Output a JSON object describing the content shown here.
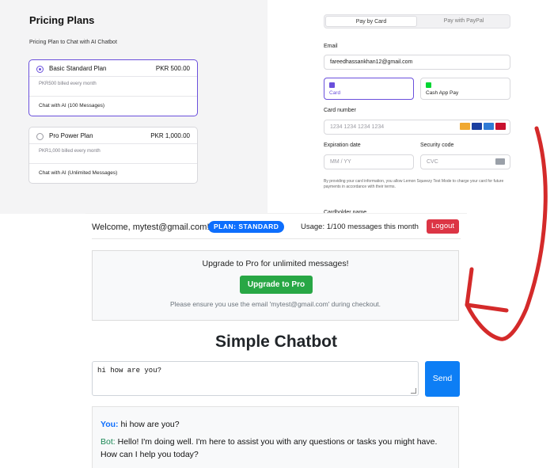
{
  "pricing": {
    "title": "Pricing Plans",
    "subtitle": "Pricing Plan to Chat with AI Chatbot",
    "plans": [
      {
        "name": "Basic Standard Plan",
        "price": "PKR 500.00",
        "billed": "PKR500 billed every month",
        "feature": "Chat with AI (100 Messages)",
        "selected": true
      },
      {
        "name": "Pro Power Plan",
        "price": "PKR 1,000.00",
        "billed": "PKR1,000 billed every month",
        "feature": "Chat with AI (Unlimited Messages)",
        "selected": false
      }
    ]
  },
  "payment": {
    "tabs": [
      "Pay by Card",
      "Pay with PayPal"
    ],
    "email_label": "Email",
    "email_value": "fareedhassankhan12@gmail.com",
    "methods": [
      {
        "label": "Card",
        "icon": "card-icon",
        "color": "#6a4fdc"
      },
      {
        "label": "Cash App Pay",
        "icon": "cash-app-icon",
        "color": "#00d632"
      }
    ],
    "card_number_label": "Card number",
    "card_number_placeholder": "1234 1234 1234 1234",
    "expiration_label": "Expiration date",
    "expiration_placeholder": "MM / YY",
    "security_label": "Security code",
    "security_placeholder": "CVC",
    "disclaimer": "By providing your card information, you allow Lemon Squeezy Test Mode to charge your card for future payments in accordance with their terms.",
    "cardholder_label": "Cardholder name"
  },
  "chat": {
    "welcome": "Welcome, mytest@gmail.com!",
    "plan_badge": "PLAN: STANDARD",
    "usage": "Usage: 1/100 messages this month",
    "logout": "Logout",
    "upgrade_title": "Upgrade to Pro for unlimited messages!",
    "upgrade_button": "Upgrade to Pro",
    "upgrade_note": "Please ensure you use the email 'mytest@gmail.com' during checkout.",
    "app_title": "Simple Chatbot",
    "input_value": "hi how are you?",
    "send": "Send",
    "messages": [
      {
        "who": "You:",
        "text": " hi how are you?"
      },
      {
        "who": "Bot:",
        "text": " Hello! I'm doing well. I'm here to assist you with any questions or tasks you might have. How can I help you today?"
      }
    ]
  },
  "colors": {
    "accent_purple": "#6a4fdc",
    "badge_blue": "#0d6efd",
    "logout_red": "#dc3545",
    "upgrade_green": "#28a745",
    "arrow_red": "#d42a2a"
  }
}
